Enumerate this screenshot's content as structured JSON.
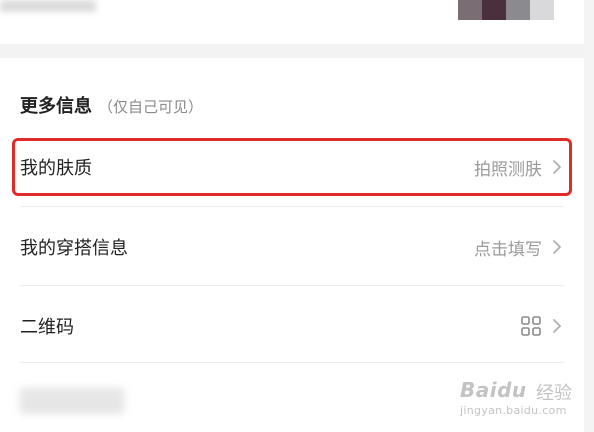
{
  "colors": {
    "highlight_border": "#e12a2a",
    "label_text": "#222222",
    "secondary_text": "#9a9a9a",
    "divider": "#ececec",
    "avatar_pixels": [
      "#7a6e74",
      "#4a2f3e",
      "#8b8a8e",
      "#d9d9dc"
    ]
  },
  "section": {
    "title": "更多信息",
    "subtitle": "（仅自己可见）"
  },
  "rows": [
    {
      "label": "我的肤质",
      "value": "拍照测肤",
      "icon": "chevron-right-icon",
      "highlighted": true
    },
    {
      "label": "我的穿搭信息",
      "value": "点击填写",
      "icon": "chevron-right-icon",
      "highlighted": false
    },
    {
      "label": "二维码",
      "value": "",
      "icon": "qr-grid-icon",
      "highlighted": false
    }
  ],
  "watermark": {
    "brand": "Baidu",
    "cn": "经验",
    "url": "jingyan.baidu.com"
  }
}
